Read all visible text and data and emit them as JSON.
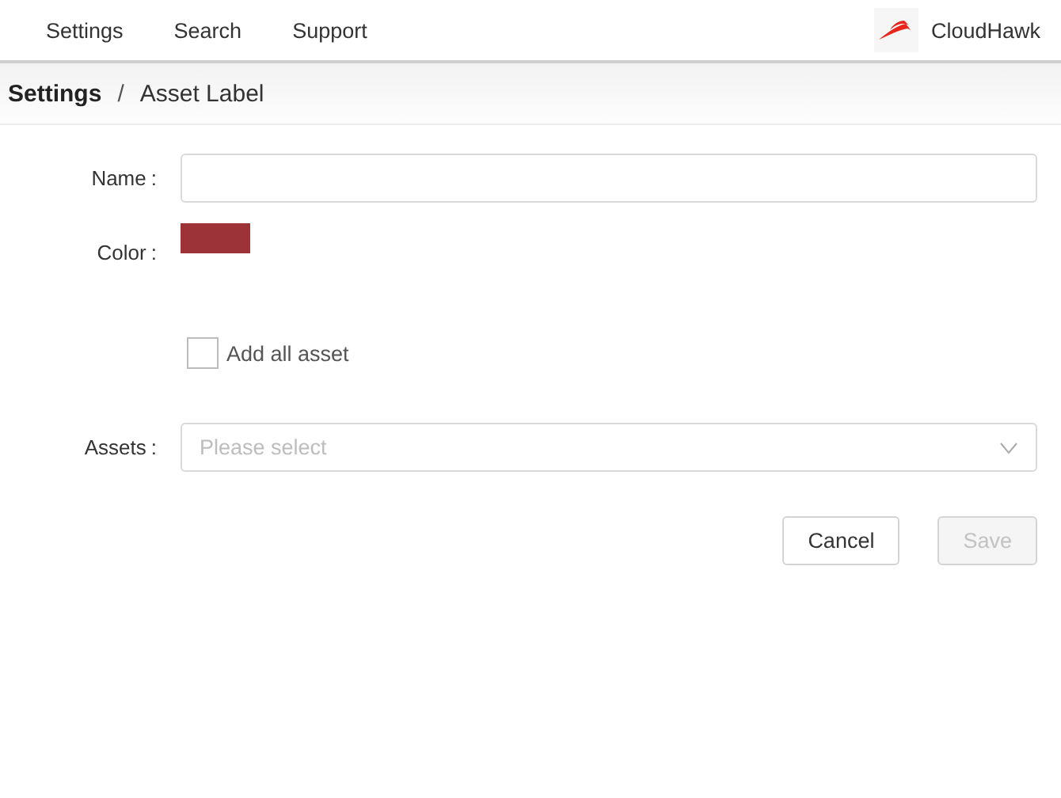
{
  "nav": {
    "items": [
      {
        "label": "Settings"
      },
      {
        "label": "Search"
      },
      {
        "label": "Support"
      }
    ],
    "brand": "CloudHawk"
  },
  "breadcrumb": [
    {
      "label": "Settings",
      "current": false
    },
    {
      "label": "Asset Label",
      "current": true
    }
  ],
  "breadcrumb_separator": "/",
  "form": {
    "fields": [
      {
        "kind": "text",
        "label": "Name",
        "separator": ":"
      },
      {
        "kind": "color",
        "label": "Color",
        "separator": ":",
        "color": "#9b3339"
      },
      {
        "kind": "checkbox",
        "text": "Add all asset",
        "checked": false
      },
      {
        "kind": "select",
        "label": "Assets",
        "separator": ":",
        "placeholder": "Please select"
      }
    ],
    "buttons": [
      {
        "label": "Cancel",
        "disabled": false
      },
      {
        "label": "Save",
        "disabled": true
      }
    ]
  }
}
